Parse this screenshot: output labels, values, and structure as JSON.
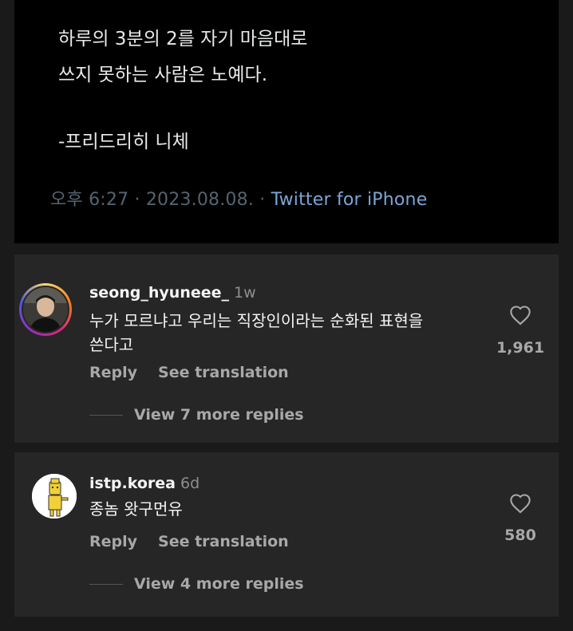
{
  "tweet": {
    "line1": "하루의 3분의 2를 자기 마음대로",
    "line2": "쓰지 못하는 사람은 노예다.",
    "attribution": "-프리드리히 니체",
    "time": "오후 6:27 · 2023.08.08. · ",
    "source": "Twitter for iPhone"
  },
  "comments": [
    {
      "username": "seong_hyuneee_",
      "age": "1w",
      "text_line1": "누가 모르냐고 우리는 직장인이라는 순화된 표현을",
      "text_line2": "쓴다고",
      "reply": "Reply",
      "translate": "See translation",
      "replies": "View 7 more replies",
      "likes": "1,961",
      "like_icon": "heart-outline-icon",
      "avatar_ring": true
    },
    {
      "username": "istp.korea",
      "age": "6d",
      "text_line1": "종놈 왓구먼유",
      "reply": "Reply",
      "translate": "See translation",
      "replies": "View 4 more replies",
      "likes": "580",
      "like_icon": "heart-outline-icon",
      "avatar_ring": false
    }
  ],
  "colors": {
    "page_bg": "#1a1a1a",
    "tweet_bg": "#000000",
    "comment_bg": "#262626",
    "link_blue": "#7aa7d6"
  }
}
